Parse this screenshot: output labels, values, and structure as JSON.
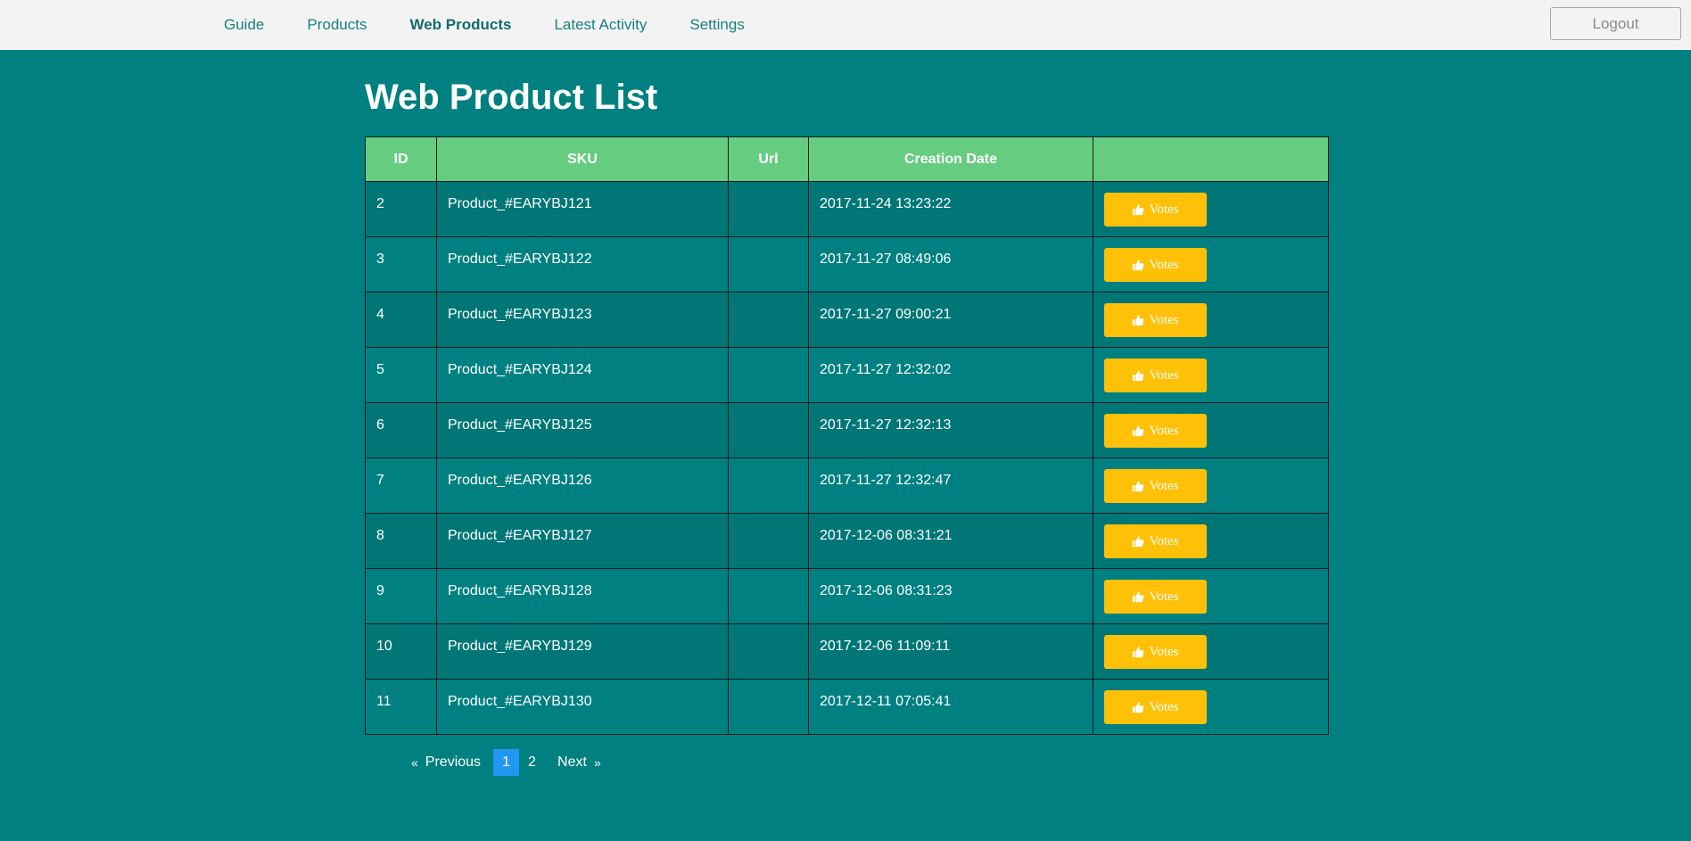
{
  "nav": {
    "items": [
      {
        "label": "Guide"
      },
      {
        "label": "Products"
      },
      {
        "label": "Web Products"
      },
      {
        "label": "Latest Activity"
      },
      {
        "label": "Settings"
      }
    ],
    "active": "Web Products",
    "logout_label": "Logout"
  },
  "page": {
    "title": "Web Product List"
  },
  "table": {
    "headers": [
      "ID",
      "SKU",
      "Url",
      "Creation Date",
      ""
    ],
    "rows": [
      {
        "id": "2",
        "sku": "Product_#EARYBJ121",
        "url": "",
        "date": "2017-11-24 13:23:22",
        "action": "Votes"
      },
      {
        "id": "3",
        "sku": "Product_#EARYBJ122",
        "url": "",
        "date": "2017-11-27 08:49:06",
        "action": "Votes"
      },
      {
        "id": "4",
        "sku": "Product_#EARYBJ123",
        "url": "",
        "date": "2017-11-27 09:00:21",
        "action": "Votes"
      },
      {
        "id": "5",
        "sku": "Product_#EARYBJ124",
        "url": "",
        "date": "2017-11-27 12:32:02",
        "action": "Votes"
      },
      {
        "id": "6",
        "sku": "Product_#EARYBJ125",
        "url": "",
        "date": "2017-11-27 12:32:13",
        "action": "Votes"
      },
      {
        "id": "7",
        "sku": "Product_#EARYBJ126",
        "url": "",
        "date": "2017-11-27 12:32:47",
        "action": "Votes"
      },
      {
        "id": "8",
        "sku": "Product_#EARYBJ127",
        "url": "",
        "date": "2017-12-06 08:31:21",
        "action": "Votes"
      },
      {
        "id": "9",
        "sku": "Product_#EARYBJ128",
        "url": "",
        "date": "2017-12-06 08:31:23",
        "action": "Votes"
      },
      {
        "id": "10",
        "sku": "Product_#EARYBJ129",
        "url": "",
        "date": "2017-12-06 11:09:11",
        "action": "Votes"
      },
      {
        "id": "11",
        "sku": "Product_#EARYBJ130",
        "url": "",
        "date": "2017-12-11 07:05:41",
        "action": "Votes"
      }
    ],
    "vote_icon": "thumbs-up-icon"
  },
  "pagination": {
    "prev_arrow": "«",
    "prev_label": "Previous",
    "pages": [
      "1",
      "2"
    ],
    "current": "1",
    "next_label": "Next",
    "next_arrow": "»"
  },
  "colors": {
    "background": "#008080",
    "header": "#66cc80",
    "vote_button": "#ffc107",
    "current_page": "#2196f3"
  }
}
